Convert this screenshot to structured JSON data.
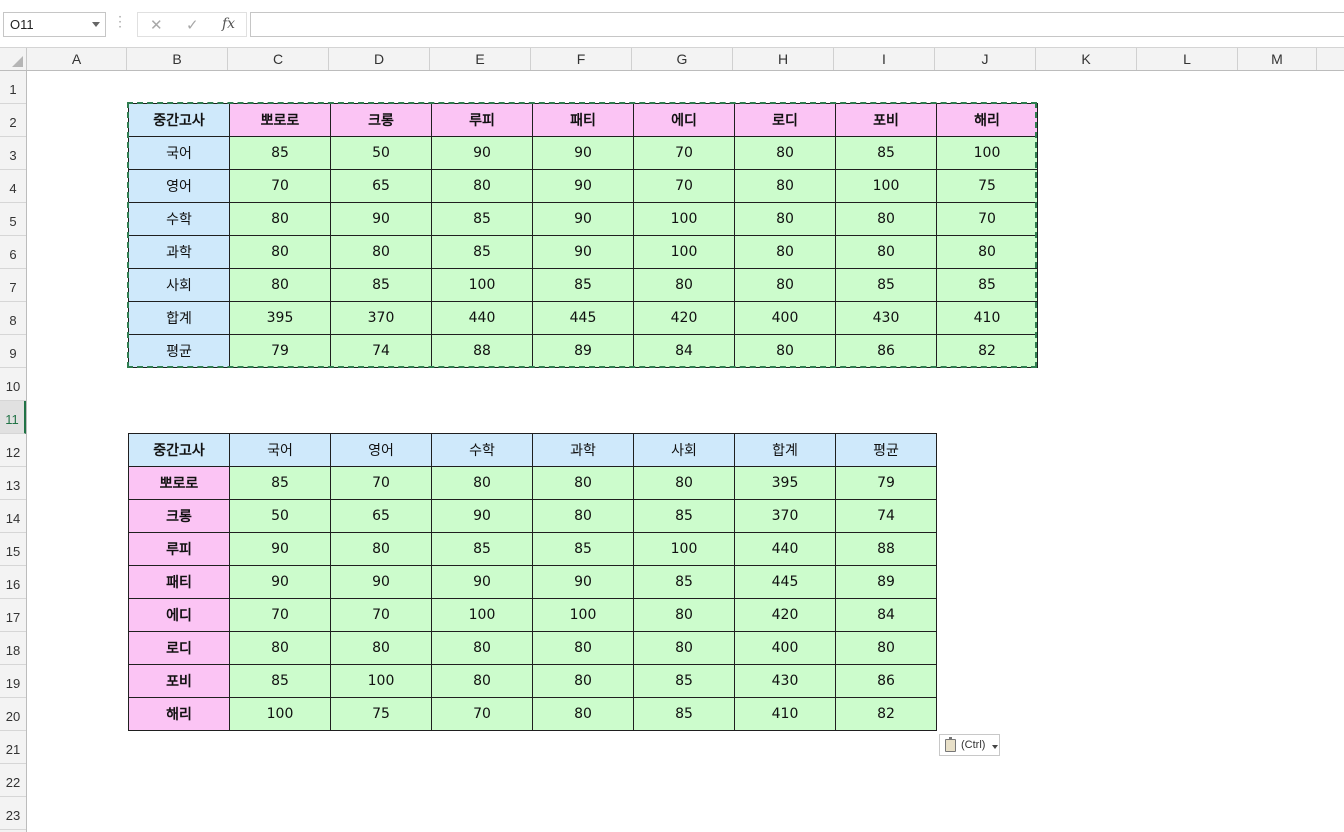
{
  "formula_bar": {
    "name_box": "O11",
    "cancel_glyph": "✕",
    "enter_glyph": "✓",
    "function_glyph": "fx",
    "formula": ""
  },
  "columns": [
    "A",
    "B",
    "C",
    "D",
    "E",
    "F",
    "G",
    "H",
    "I",
    "J",
    "K",
    "L",
    "M"
  ],
  "rows": [
    "1",
    "2",
    "3",
    "4",
    "5",
    "6",
    "7",
    "8",
    "9",
    "10",
    "11",
    "12",
    "13",
    "14",
    "15",
    "16",
    "17",
    "18",
    "19",
    "20",
    "21",
    "22",
    "23"
  ],
  "selected_row": "11",
  "table1": {
    "corner": "중간고사",
    "headers": [
      "뽀로로",
      "크롱",
      "루피",
      "패티",
      "에디",
      "로디",
      "포비",
      "해리"
    ],
    "rows": [
      {
        "label": "국어",
        "values": [
          "85",
          "50",
          "90",
          "90",
          "70",
          "80",
          "85",
          "100"
        ]
      },
      {
        "label": "영어",
        "values": [
          "70",
          "65",
          "80",
          "90",
          "70",
          "80",
          "100",
          "75"
        ]
      },
      {
        "label": "수학",
        "values": [
          "80",
          "90",
          "85",
          "90",
          "100",
          "80",
          "80",
          "70"
        ]
      },
      {
        "label": "과학",
        "values": [
          "80",
          "80",
          "85",
          "90",
          "100",
          "80",
          "80",
          "80"
        ]
      },
      {
        "label": "사회",
        "values": [
          "80",
          "85",
          "100",
          "85",
          "80",
          "80",
          "85",
          "85"
        ]
      },
      {
        "label": "합계",
        "values": [
          "395",
          "370",
          "440",
          "445",
          "420",
          "400",
          "430",
          "410"
        ]
      },
      {
        "label": "평균",
        "values": [
          "79",
          "74",
          "88",
          "89",
          "84",
          "80",
          "86",
          "82"
        ]
      }
    ]
  },
  "table2": {
    "corner": "중간고사",
    "headers": [
      "국어",
      "영어",
      "수학",
      "과학",
      "사회",
      "합계",
      "평균"
    ],
    "rows": [
      {
        "label": "뽀로로",
        "values": [
          "85",
          "70",
          "80",
          "80",
          "80",
          "395",
          "79"
        ]
      },
      {
        "label": "크롱",
        "values": [
          "50",
          "65",
          "90",
          "80",
          "85",
          "370",
          "74"
        ]
      },
      {
        "label": "루피",
        "values": [
          "90",
          "80",
          "85",
          "85",
          "100",
          "440",
          "88"
        ]
      },
      {
        "label": "패티",
        "values": [
          "90",
          "90",
          "90",
          "90",
          "85",
          "445",
          "89"
        ]
      },
      {
        "label": "에디",
        "values": [
          "70",
          "70",
          "100",
          "100",
          "80",
          "420",
          "84"
        ]
      },
      {
        "label": "로디",
        "values": [
          "80",
          "80",
          "80",
          "80",
          "80",
          "400",
          "80"
        ]
      },
      {
        "label": "포비",
        "values": [
          "85",
          "100",
          "80",
          "80",
          "85",
          "430",
          "86"
        ]
      },
      {
        "label": "해리",
        "values": [
          "100",
          "75",
          "70",
          "80",
          "85",
          "410",
          "82"
        ]
      }
    ]
  },
  "paste_options": {
    "label": "(Ctrl)"
  },
  "colors": {
    "header_blue": "#cfe9fb",
    "name_pink": "#fbc4f4",
    "value_green": "#ccfccc",
    "selection_green": "#217346"
  }
}
